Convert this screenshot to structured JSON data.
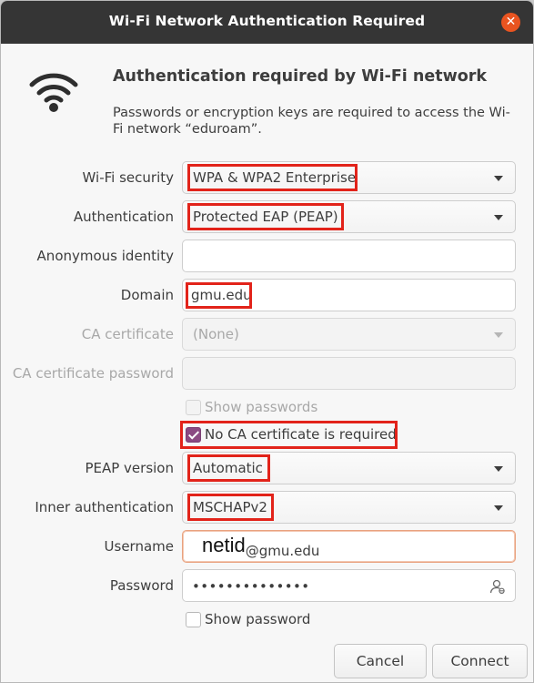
{
  "window": {
    "title": "Wi-Fi Network Authentication Required",
    "close_icon": "close-icon"
  },
  "header": {
    "heading": "Authentication required by Wi-Fi network",
    "description": "Passwords or encryption keys are required to access the Wi-Fi network “eduroam”.",
    "icon": "wifi-icon"
  },
  "form": {
    "wifi_security": {
      "label": "Wi-Fi security",
      "value": "WPA & WPA2 Enterprise"
    },
    "authentication": {
      "label": "Authentication",
      "value": "Protected EAP (PEAP)"
    },
    "anonymous_identity": {
      "label": "Anonymous identity",
      "value": ""
    },
    "domain": {
      "label": "Domain",
      "value": "gmu.edu"
    },
    "ca_certificate": {
      "label": "CA certificate",
      "value": "(None)"
    },
    "ca_certificate_password": {
      "label": "CA certificate password",
      "value": ""
    },
    "show_passwords": {
      "label": "Show passwords",
      "checked": false
    },
    "no_ca_required": {
      "label": "No CA certificate is required",
      "checked": true
    },
    "peap_version": {
      "label": "PEAP version",
      "value": "Automatic"
    },
    "inner_authentication": {
      "label": "Inner authentication",
      "value": "MSCHAPv2"
    },
    "username": {
      "label": "Username",
      "netid": "netid",
      "domain_part": "@gmu.edu"
    },
    "password": {
      "label": "Password",
      "masked_value": "••••••••••••••"
    },
    "show_password": {
      "label": "Show password",
      "checked": false
    }
  },
  "buttons": {
    "cancel": "Cancel",
    "connect": "Connect"
  },
  "colors": {
    "accent": "#e95420",
    "highlight": "#e2231a",
    "checkbox": "#8b4a83",
    "titlebar": "#353535"
  }
}
